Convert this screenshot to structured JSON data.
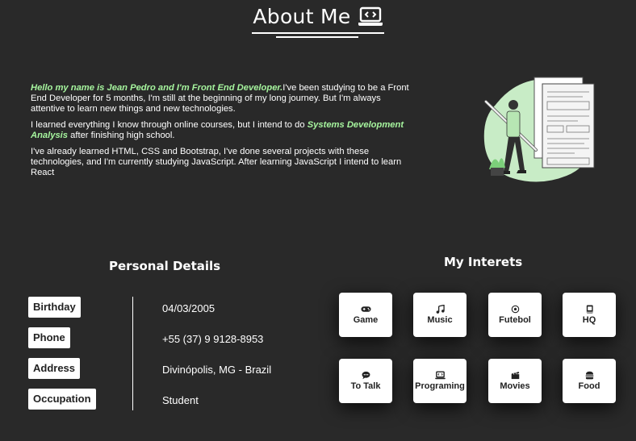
{
  "header": {
    "title": "About Me",
    "icon": "laptop-code-icon"
  },
  "intro": {
    "p1_highlight": "Hello my name is Jean Pedro and I'm Front End Developer.",
    "p1_text": "I've been studying to be a Front End Developer for 5 months, I'm still at the beginning of my long journey. But I'm always attentive to learn new things and new technologies.",
    "p2_text_before": "I learned everything I know through online courses, but I intend to do ",
    "p2_highlight": "Systems Development Analysis",
    "p2_text_after": " after finishing high school.",
    "p3_text": "I've already learned HTML, CSS and Bootstrap, I've done several projects with these technologies, and I'm currently studying JavaScript. After learning JavaScript I intend to learn React"
  },
  "personal_details": {
    "title": "Personal Details",
    "rows": [
      {
        "label": "Birthday",
        "value": "04/03/2005"
      },
      {
        "label": "Phone",
        "value": "+55 (37) 9 9128-8953"
      },
      {
        "label": "Address",
        "value": "Divinópolis, MG - Brazil"
      },
      {
        "label": "Occupation",
        "value": "Student"
      }
    ]
  },
  "interests": {
    "title": "My Interets",
    "items": [
      {
        "label": "Game",
        "icon": "gamepad-icon"
      },
      {
        "label": "Music",
        "icon": "music-note-icon"
      },
      {
        "label": "Futebol",
        "icon": "soccer-ball-icon"
      },
      {
        "label": "HQ",
        "icon": "book-icon"
      },
      {
        "label": "To Talk",
        "icon": "chat-bubble-icon"
      },
      {
        "label": "Programing",
        "icon": "laptop-code-icon"
      },
      {
        "label": "Movies",
        "icon": "clapperboard-icon"
      },
      {
        "label": "Food",
        "icon": "burger-icon"
      }
    ]
  },
  "colors": {
    "background": "#292929",
    "highlight": "#a6f59e",
    "card": "#ffffff"
  }
}
